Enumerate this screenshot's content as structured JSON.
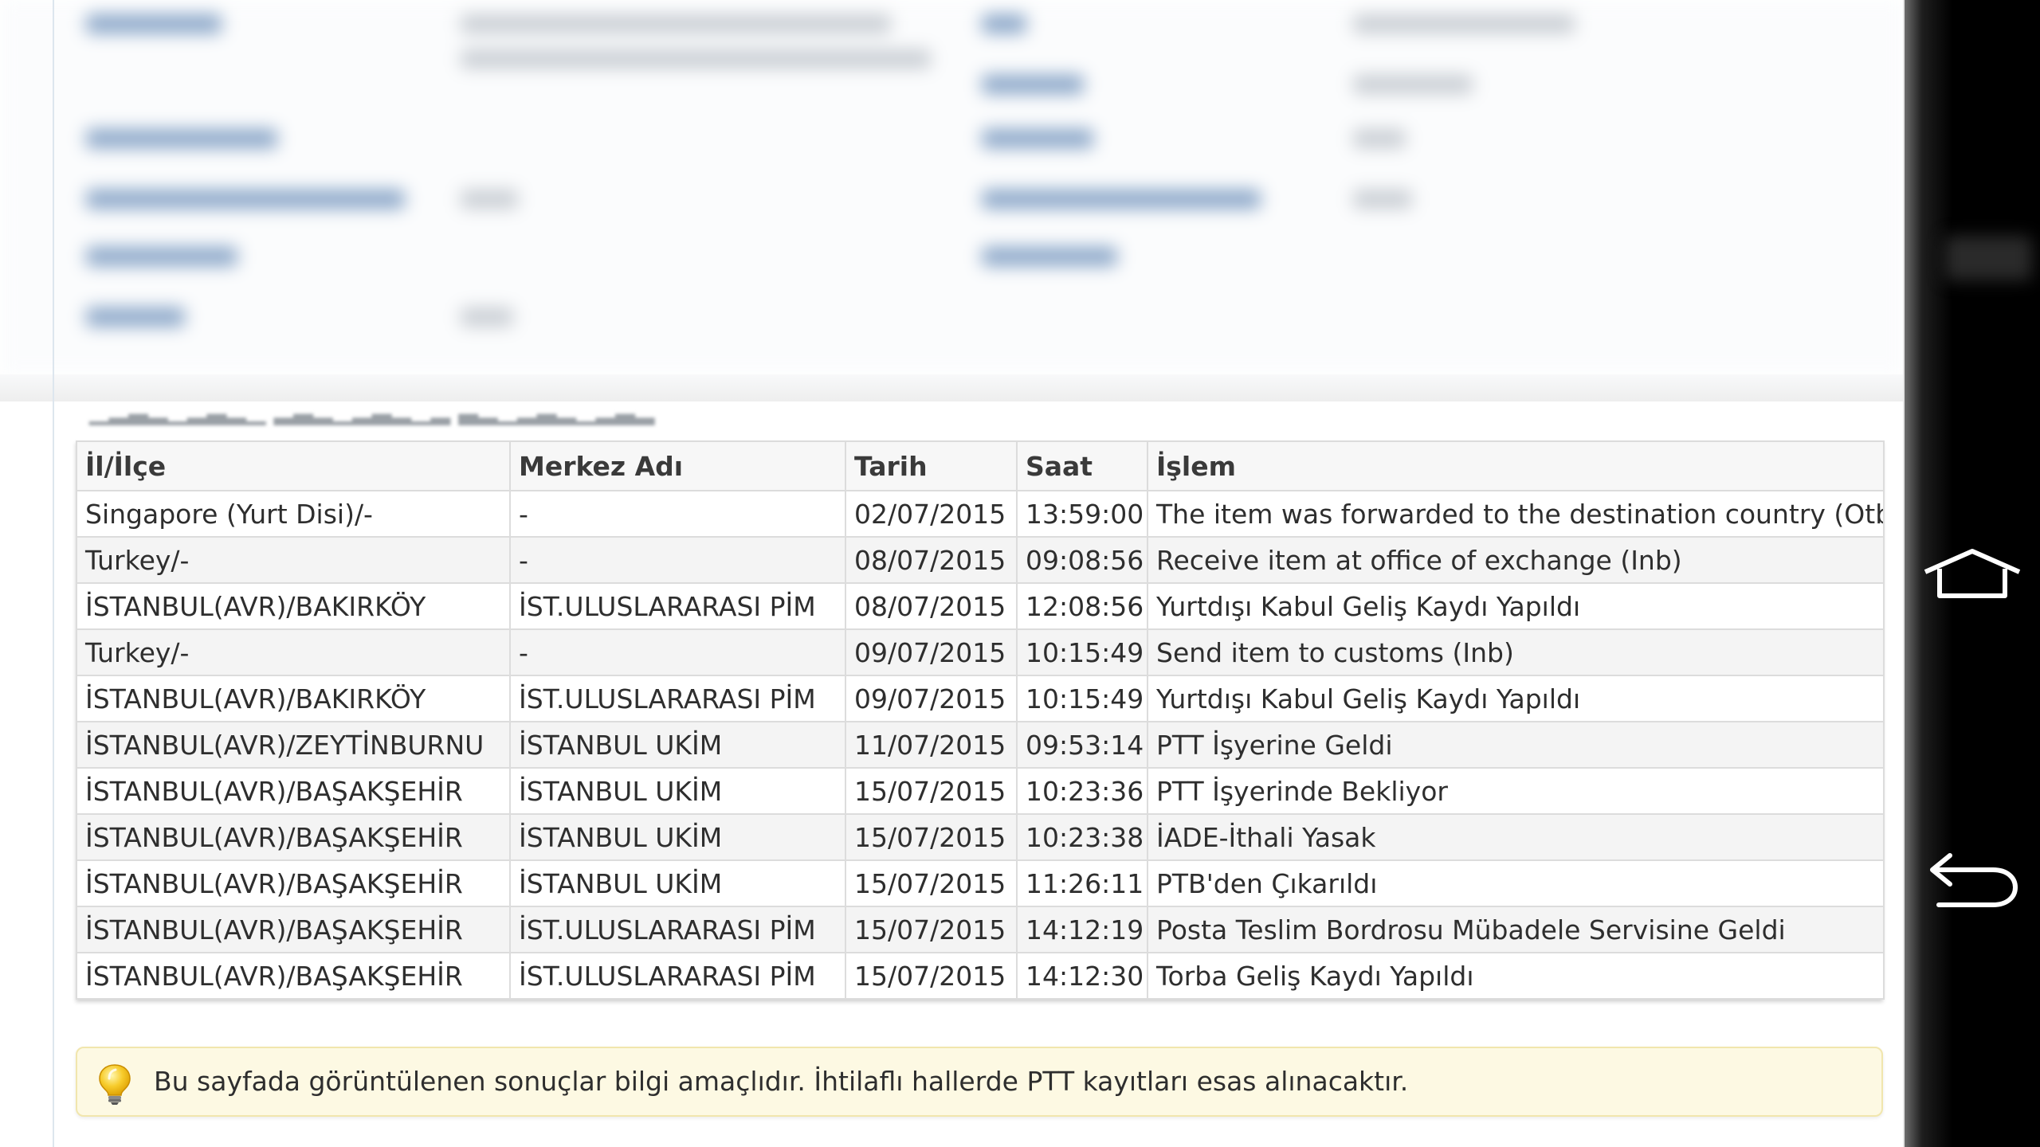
{
  "table": {
    "columns": [
      "İl/İlçe",
      "Merkez Adı",
      "Tarih",
      "Saat",
      "İşlem"
    ],
    "rows": [
      [
        "Singapore (Yurt Disi)/-",
        "-",
        "02/07/2015",
        "13:59:00",
        "The item was forwarded to the destination country (Otb)"
      ],
      [
        "Turkey/-",
        "-",
        "08/07/2015",
        "09:08:56",
        "Receive item at office of exchange (Inb)"
      ],
      [
        "İSTANBUL(AVR)/BAKIRKÖY",
        "İST.ULUSLARARASI PİM",
        "08/07/2015",
        "12:08:56",
        "Yurtdışı Kabul Geliş Kaydı Yapıldı"
      ],
      [
        "Turkey/-",
        "-",
        "09/07/2015",
        "10:15:49",
        "Send item to customs (Inb)"
      ],
      [
        "İSTANBUL(AVR)/BAKIRKÖY",
        "İST.ULUSLARARASI PİM",
        "09/07/2015",
        "10:15:49",
        "Yurtdışı Kabul Geliş Kaydı Yapıldı"
      ],
      [
        "İSTANBUL(AVR)/ZEYTİNBURNU",
        "İSTANBUL UKİM",
        "11/07/2015",
        "09:53:14",
        "PTT İşyerine Geldi"
      ],
      [
        "İSTANBUL(AVR)/BAŞAKŞEHİR",
        "İSTANBUL UKİM",
        "15/07/2015",
        "10:23:36",
        "PTT İşyerinde Bekliyor"
      ],
      [
        "İSTANBUL(AVR)/BAŞAKŞEHİR",
        "İSTANBUL UKİM",
        "15/07/2015",
        "10:23:38",
        "İADE-İthali Yasak"
      ],
      [
        "İSTANBUL(AVR)/BAŞAKŞEHİR",
        "İSTANBUL UKİM",
        "15/07/2015",
        "11:26:11",
        "PTB'den Çıkarıldı"
      ],
      [
        "İSTANBUL(AVR)/BAŞAKŞEHİR",
        "İST.ULUSLARARASI PİM",
        "15/07/2015",
        "14:12:19",
        "Posta Teslim Bordrosu Mübadele Servisine Geldi"
      ],
      [
        "İSTANBUL(AVR)/BAŞAKŞEHİR",
        "İST.ULUSLARARASI PİM",
        "15/07/2015",
        "14:12:30",
        "Torba Geliş Kaydı Yapıldı"
      ]
    ]
  },
  "note": {
    "icon": "lightbulb-icon",
    "text": "Bu sayfada görüntülenen sonuçlar bilgi amaçlıdır. İhtilaflı hallerde PTT kayıtları esas alınacaktır."
  },
  "navbar": {
    "home_icon": "home-icon",
    "back_icon": "back-icon"
  },
  "colors": {
    "note_background": "#fdf9e3",
    "note_border": "#f1e6ad",
    "table_border": "#dcdcdc",
    "row_alt": "#f4f4f4",
    "navbar": "#000000"
  }
}
